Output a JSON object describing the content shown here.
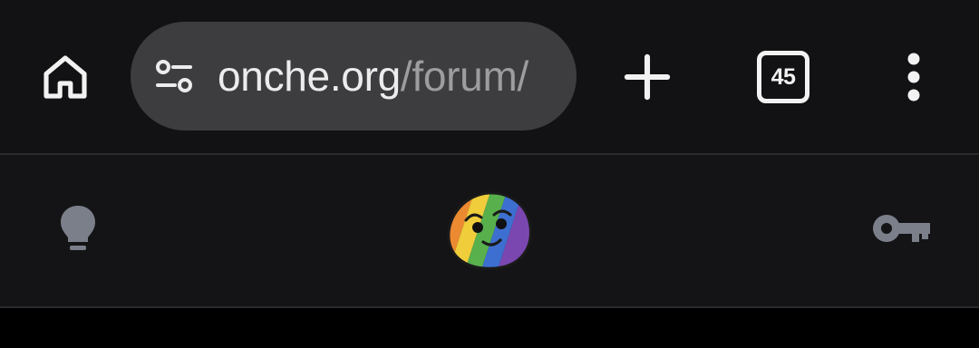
{
  "browser": {
    "url": {
      "domain": "onche.org",
      "path": "/forum/"
    },
    "tab_count": "45",
    "icons": {
      "home": "home-icon",
      "site_info": "tune-icon",
      "new_tab": "plus-icon",
      "menu": "more-vert-icon"
    }
  },
  "site_header": {
    "icons": {
      "left": "lightbulb-icon",
      "logo": "rainbow-smiley-logo",
      "right": "key-icon"
    }
  },
  "colors": {
    "toolbar_bg": "#121214",
    "omnibox_bg": "#3d3d40",
    "header_bg": "#141416",
    "header_icon": "#7b7f8a",
    "icon_white": "#f2f2f2"
  }
}
